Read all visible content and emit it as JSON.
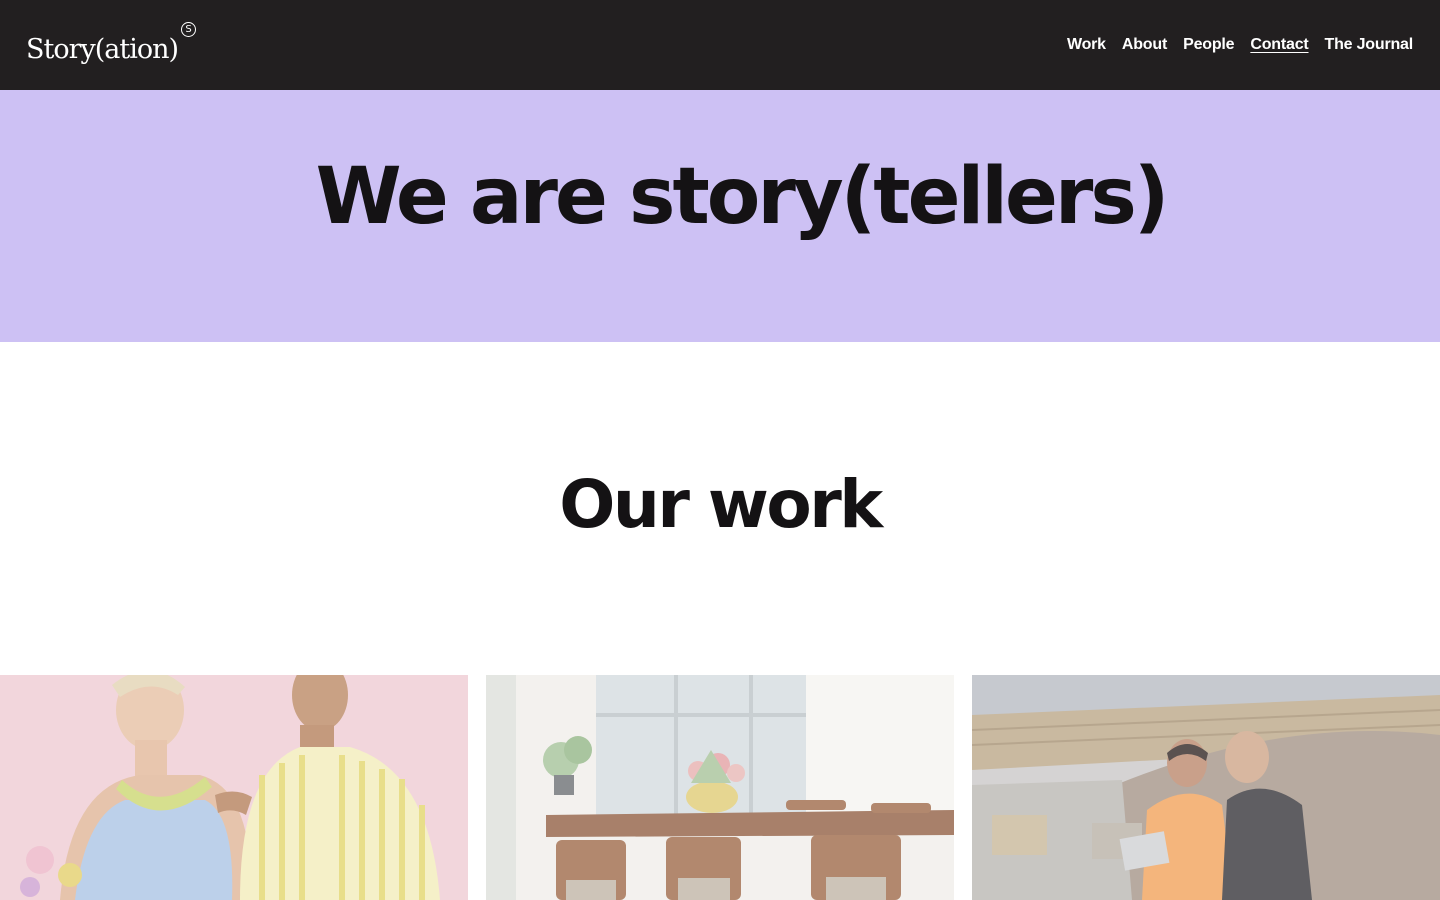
{
  "header": {
    "logo_text": "Story(ation)",
    "logo_mark": "S",
    "nav": [
      {
        "label": "Work"
      },
      {
        "label": "About"
      },
      {
        "label": "People"
      },
      {
        "label": "Contact",
        "active": true
      },
      {
        "label": "The Journal"
      }
    ]
  },
  "hero": {
    "title": "We are story(tellers)",
    "background": "#cdc1f4"
  },
  "work": {
    "title": "Our work",
    "cards": [
      {
        "image": "fashion-models-photo"
      },
      {
        "image": "dining-room-photo"
      },
      {
        "image": "construction-site-photo"
      }
    ]
  },
  "colors": {
    "header_bg": "#221f20",
    "accent": "#cdc1f4",
    "text": "#141214"
  }
}
